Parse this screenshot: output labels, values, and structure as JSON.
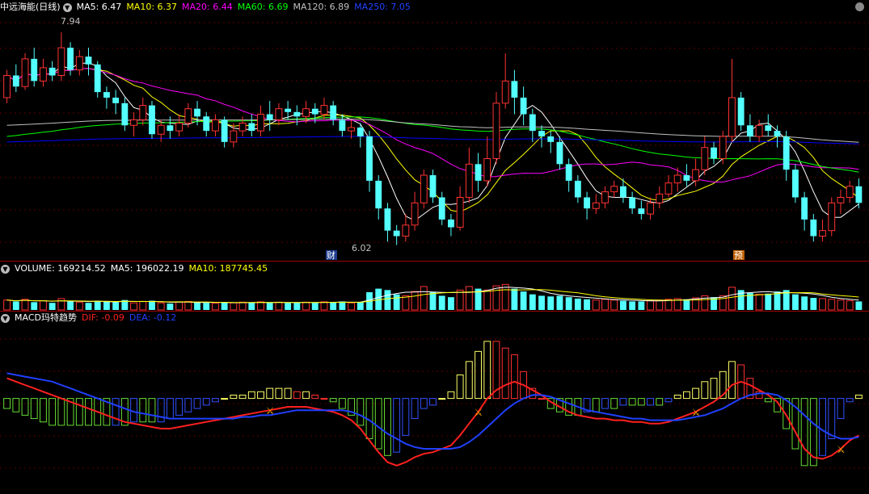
{
  "price_header": {
    "name": "中远海能(日线)",
    "ma5": "MA5: 6.47",
    "ma10": "MA10: 6.37",
    "ma20": "MA20: 6.44",
    "ma60": "MA60: 6.69",
    "ma120": "MA120: 6.89",
    "ma250": "MA250: 7.05"
  },
  "volume_header": {
    "volume": "VOLUME: 169214.52",
    "ma5": "MA5: 196022.19",
    "ma10": "MA10: 187745.45"
  },
  "macd_header": {
    "name": "MACD玛特趋势",
    "dif": "DIF: -0.09",
    "dea": "DEA: -0.12"
  },
  "annotations": {
    "high_label": "7.94",
    "low_label": "6.02",
    "marker_cai": "财",
    "marker_yu": "预"
  },
  "colors": {
    "up": "#ff3232",
    "down": "#54ffff",
    "ma5": "#ffffff",
    "ma10": "#ffff00",
    "ma20": "#ff00ff",
    "ma60": "#00ff00",
    "ma120": "#c0c0c0",
    "ma250": "#0000ff",
    "dif": "#ff2020",
    "dea": "#2040ff",
    "separator": "#a00000"
  },
  "chart_data": {
    "type": "candlestick",
    "price_points": {
      "high": 7.94,
      "low": 6.02
    },
    "candles": [
      [
        7.35,
        7.55,
        7.3,
        7.6
      ],
      [
        7.55,
        7.45,
        7.4,
        7.65
      ],
      [
        7.45,
        7.7,
        7.42,
        7.75
      ],
      [
        7.7,
        7.5,
        7.45,
        7.8
      ],
      [
        7.5,
        7.62,
        7.45,
        7.7
      ],
      [
        7.62,
        7.55,
        7.5,
        7.68
      ],
      [
        7.55,
        7.8,
        7.5,
        7.94
      ],
      [
        7.8,
        7.6,
        7.55,
        7.85
      ],
      [
        7.6,
        7.72,
        7.55,
        7.78
      ],
      [
        7.72,
        7.65,
        7.55,
        7.8
      ],
      [
        7.65,
        7.4,
        7.35,
        7.68
      ],
      [
        7.4,
        7.35,
        7.25,
        7.45
      ],
      [
        7.35,
        7.3,
        7.2,
        7.42
      ],
      [
        7.3,
        7.1,
        7.05,
        7.35
      ],
      [
        7.1,
        7.15,
        7.0,
        7.22
      ],
      [
        7.15,
        7.28,
        7.1,
        7.35
      ],
      [
        7.28,
        7.02,
        6.98,
        7.32
      ],
      [
        7.02,
        7.1,
        6.95,
        7.15
      ],
      [
        7.1,
        7.05,
        6.98,
        7.18
      ],
      [
        7.05,
        7.12,
        7.0,
        7.2
      ],
      [
        7.12,
        7.25,
        7.08,
        7.3
      ],
      [
        7.25,
        7.18,
        7.1,
        7.32
      ],
      [
        7.18,
        7.05,
        7.0,
        7.22
      ],
      [
        7.05,
        7.15,
        7.0,
        7.2
      ],
      [
        7.15,
        6.95,
        6.9,
        7.18
      ],
      [
        6.95,
        7.05,
        6.9,
        7.12
      ],
      [
        7.05,
        7.12,
        7.0,
        7.18
      ],
      [
        7.12,
        7.05,
        7.0,
        7.2
      ],
      [
        7.05,
        7.2,
        7.0,
        7.28
      ],
      [
        7.2,
        7.15,
        7.05,
        7.32
      ],
      [
        7.15,
        7.25,
        7.1,
        7.3
      ],
      [
        7.25,
        7.22,
        7.15,
        7.32
      ],
      [
        7.22,
        7.18,
        7.1,
        7.28
      ],
      [
        7.18,
        7.25,
        7.12,
        7.32
      ],
      [
        7.25,
        7.2,
        7.12,
        7.3
      ],
      [
        7.2,
        7.28,
        7.15,
        7.35
      ],
      [
        7.28,
        7.15,
        7.1,
        7.32
      ],
      [
        7.15,
        7.05,
        7.0,
        7.2
      ],
      [
        7.05,
        7.08,
        6.98,
        7.15
      ],
      [
        7.08,
        7.0,
        6.9,
        7.12
      ],
      [
        7.0,
        6.6,
        6.5,
        7.05
      ],
      [
        6.6,
        6.35,
        6.25,
        6.65
      ],
      [
        6.35,
        6.15,
        6.05,
        6.4
      ],
      [
        6.15,
        6.1,
        6.02,
        6.2
      ],
      [
        6.1,
        6.2,
        6.05,
        6.3
      ],
      [
        6.2,
        6.4,
        6.15,
        6.5
      ],
      [
        6.4,
        6.65,
        6.35,
        6.7
      ],
      [
        6.65,
        6.45,
        6.4,
        6.7
      ],
      [
        6.45,
        6.25,
        6.2,
        6.5
      ],
      [
        6.25,
        6.18,
        6.1,
        6.3
      ],
      [
        6.18,
        6.45,
        6.15,
        6.55
      ],
      [
        6.45,
        6.75,
        6.4,
        6.9
      ],
      [
        6.75,
        6.6,
        6.5,
        6.85
      ],
      [
        6.6,
        6.8,
        6.55,
        7.0
      ],
      [
        6.8,
        7.3,
        6.75,
        7.4
      ],
      [
        7.3,
        7.5,
        7.25,
        7.75
      ],
      [
        7.5,
        7.35,
        7.2,
        7.6
      ],
      [
        7.35,
        7.2,
        7.1,
        7.45
      ],
      [
        7.2,
        7.05,
        6.95,
        7.25
      ],
      [
        7.05,
        7.0,
        6.9,
        7.1
      ],
      [
        7.0,
        6.95,
        6.85,
        7.05
      ],
      [
        6.95,
        6.75,
        6.7,
        7.0
      ],
      [
        6.75,
        6.6,
        6.5,
        6.8
      ],
      [
        6.6,
        6.45,
        6.4,
        6.65
      ],
      [
        6.45,
        6.35,
        6.25,
        6.5
      ],
      [
        6.35,
        6.4,
        6.3,
        6.48
      ],
      [
        6.4,
        6.5,
        6.35,
        6.55
      ],
      [
        6.5,
        6.55,
        6.45,
        6.6
      ],
      [
        6.55,
        6.45,
        6.4,
        6.62
      ],
      [
        6.45,
        6.35,
        6.3,
        6.5
      ],
      [
        6.35,
        6.3,
        6.25,
        6.42
      ],
      [
        6.3,
        6.4,
        6.25,
        6.45
      ],
      [
        6.4,
        6.48,
        6.35,
        6.55
      ],
      [
        6.48,
        6.58,
        6.45,
        6.65
      ],
      [
        6.58,
        6.65,
        6.5,
        6.72
      ],
      [
        6.65,
        6.6,
        6.55,
        6.75
      ],
      [
        6.6,
        6.7,
        6.55,
        6.8
      ],
      [
        6.7,
        6.9,
        6.65,
        7.0
      ],
      [
        6.9,
        6.8,
        6.75,
        6.95
      ],
      [
        6.8,
        7.0,
        6.75,
        7.05
      ],
      [
        7.0,
        7.35,
        6.95,
        7.7
      ],
      [
        7.35,
        7.1,
        7.05,
        7.4
      ],
      [
        7.1,
        7.0,
        6.95,
        7.2
      ],
      [
        7.0,
        7.1,
        6.95,
        7.15
      ],
      [
        7.1,
        7.05,
        7.0,
        7.2
      ],
      [
        7.05,
        7.0,
        6.9,
        7.1
      ],
      [
        7.0,
        6.7,
        6.6,
        7.05
      ],
      [
        6.7,
        6.45,
        6.4,
        6.75
      ],
      [
        6.45,
        6.25,
        6.15,
        6.5
      ],
      [
        6.25,
        6.1,
        6.05,
        6.3
      ],
      [
        6.1,
        6.15,
        6.05,
        6.25
      ],
      [
        6.15,
        6.4,
        6.1,
        6.45
      ],
      [
        6.4,
        6.45,
        6.3,
        6.52
      ],
      [
        6.45,
        6.55,
        6.4,
        6.6
      ],
      [
        6.55,
        6.4,
        6.35,
        6.62
      ]
    ],
    "volume_scale": 500000,
    "volumes": [
      140000,
      120000,
      150000,
      110000,
      130000,
      100000,
      160000,
      120000,
      110000,
      100000,
      130000,
      120000,
      110000,
      140000,
      100000,
      120000,
      130000,
      100000,
      90000,
      110000,
      120000,
      110000,
      100000,
      95000,
      105000,
      100000,
      110000,
      105000,
      115000,
      100000,
      110000,
      100000,
      105000,
      110000,
      100000,
      115000,
      110000,
      120000,
      100000,
      110000,
      250000,
      300000,
      280000,
      220000,
      200000,
      260000,
      330000,
      250000,
      200000,
      180000,
      280000,
      330000,
      300000,
      280000,
      340000,
      360000,
      300000,
      260000,
      220000,
      200000,
      190000,
      200000,
      180000,
      160000,
      150000,
      140000,
      150000,
      140000,
      130000,
      120000,
      120000,
      130000,
      140000,
      150000,
      160000,
      150000,
      170000,
      200000,
      180000,
      200000,
      320000,
      280000,
      240000,
      220000,
      230000,
      260000,
      280000,
      220000,
      190000,
      170000,
      160000,
      150000,
      140000,
      130000,
      120000
    ],
    "dif": [
      0.12,
      0.1,
      0.08,
      0.06,
      0.04,
      0.02,
      0.0,
      -0.02,
      -0.04,
      -0.06,
      -0.08,
      -0.1,
      -0.12,
      -0.14,
      -0.15,
      -0.16,
      -0.17,
      -0.18,
      -0.18,
      -0.17,
      -0.16,
      -0.15,
      -0.14,
      -0.13,
      -0.12,
      -0.11,
      -0.1,
      -0.09,
      -0.08,
      -0.07,
      -0.06,
      -0.05,
      -0.05,
      -0.05,
      -0.06,
      -0.07,
      -0.08,
      -0.1,
      -0.13,
      -0.18,
      -0.25,
      -0.32,
      -0.38,
      -0.4,
      -0.38,
      -0.35,
      -0.33,
      -0.32,
      -0.3,
      -0.28,
      -0.22,
      -0.15,
      -0.08,
      0.0,
      0.05,
      0.08,
      0.1,
      0.08,
      0.05,
      0.02,
      -0.02,
      -0.05,
      -0.08,
      -0.1,
      -0.11,
      -0.12,
      -0.12,
      -0.13,
      -0.13,
      -0.14,
      -0.14,
      -0.15,
      -0.15,
      -0.14,
      -0.12,
      -0.1,
      -0.08,
      -0.05,
      -0.02,
      0.02,
      0.08,
      0.1,
      0.08,
      0.05,
      0.02,
      -0.02,
      -0.1,
      -0.2,
      -0.3,
      -0.35,
      -0.36,
      -0.34,
      -0.3,
      -0.25,
      -0.22
    ],
    "dea": [
      0.15,
      0.14,
      0.13,
      0.12,
      0.11,
      0.1,
      0.08,
      0.06,
      0.04,
      0.02,
      0.0,
      -0.02,
      -0.04,
      -0.06,
      -0.08,
      -0.09,
      -0.1,
      -0.11,
      -0.12,
      -0.12,
      -0.12,
      -0.12,
      -0.12,
      -0.12,
      -0.12,
      -0.12,
      -0.11,
      -0.11,
      -0.1,
      -0.1,
      -0.09,
      -0.08,
      -0.07,
      -0.07,
      -0.07,
      -0.07,
      -0.07,
      -0.07,
      -0.08,
      -0.1,
      -0.13,
      -0.17,
      -0.21,
      -0.24,
      -0.27,
      -0.29,
      -0.3,
      -0.3,
      -0.3,
      -0.3,
      -0.29,
      -0.26,
      -0.22,
      -0.17,
      -0.12,
      -0.07,
      -0.03,
      0.0,
      0.02,
      0.02,
      0.01,
      -0.01,
      -0.03,
      -0.05,
      -0.07,
      -0.08,
      -0.09,
      -0.1,
      -0.11,
      -0.12,
      -0.12,
      -0.13,
      -0.13,
      -0.13,
      -0.13,
      -0.12,
      -0.11,
      -0.1,
      -0.08,
      -0.06,
      -0.03,
      0.0,
      0.02,
      0.03,
      0.03,
      0.02,
      -0.01,
      -0.05,
      -0.1,
      -0.15,
      -0.19,
      -0.22,
      -0.24,
      -0.24,
      -0.23
    ],
    "price_ylim": [
      5.9,
      8.1
    ],
    "macd_ylim": [
      -0.55,
      0.45
    ]
  }
}
